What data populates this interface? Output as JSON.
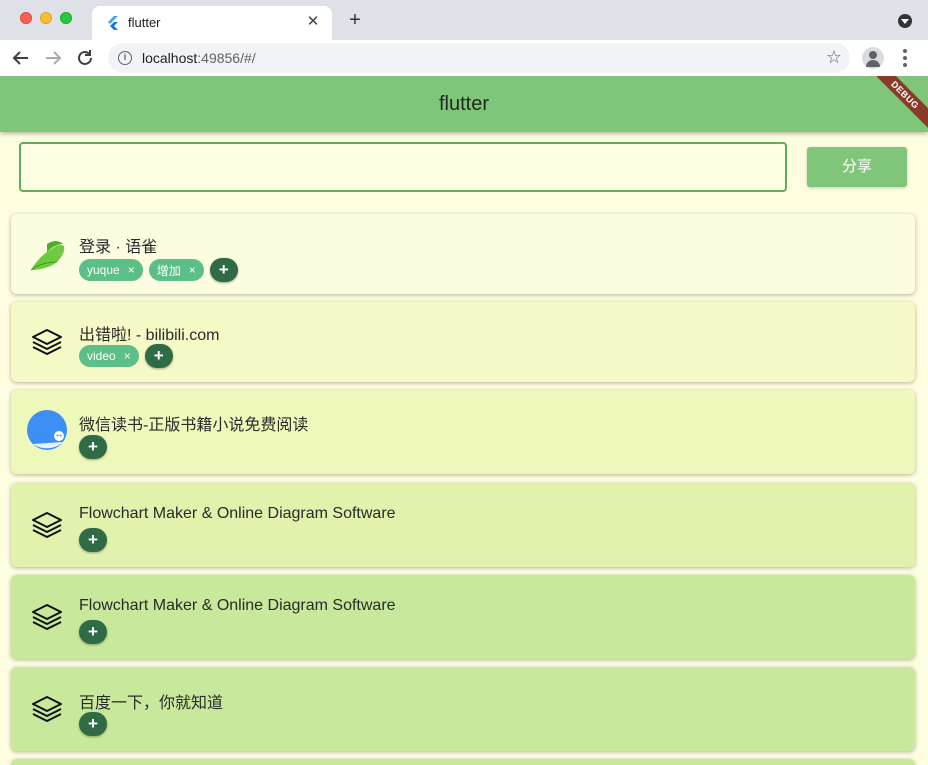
{
  "browser": {
    "tab_title": "flutter",
    "new_tab": "+",
    "url_host": "localhost",
    "url_rest": ":49856/#/"
  },
  "app": {
    "title": "flutter",
    "debug_banner": "DEBUG",
    "share_input_value": "",
    "share_button": "分享"
  },
  "items": [
    {
      "title": "登录 · 语雀",
      "icon": "yuque-bird-icon",
      "tags": [
        "yuque",
        "增加"
      ],
      "color": "#fbfce0"
    },
    {
      "title": "出错啦! - bilibili.com",
      "icon": "layers-icon",
      "tags": [
        "video"
      ],
      "color": "#f5f9c5"
    },
    {
      "title": "微信读书-正版书籍小说免费阅读",
      "icon": "weread-icon",
      "tags": [],
      "color": "#eef8ba"
    },
    {
      "title": "Flowchart Maker & Online Diagram Software",
      "icon": "layers-icon",
      "tags": [],
      "color": "#e1f2ad"
    },
    {
      "title": "Flowchart Maker & Online Diagram Software",
      "icon": "layers-icon",
      "tags": [],
      "color": "#c8e89b"
    },
    {
      "title": "百度一下，你就知道",
      "icon": "layers-icon",
      "tags": [],
      "color": "#c8e89b"
    }
  ],
  "add_label": "+",
  "tag_close": "×",
  "colors": {
    "appbar": "#7fc67b",
    "tag": "#5bbf87",
    "add": "#2f6b45"
  }
}
